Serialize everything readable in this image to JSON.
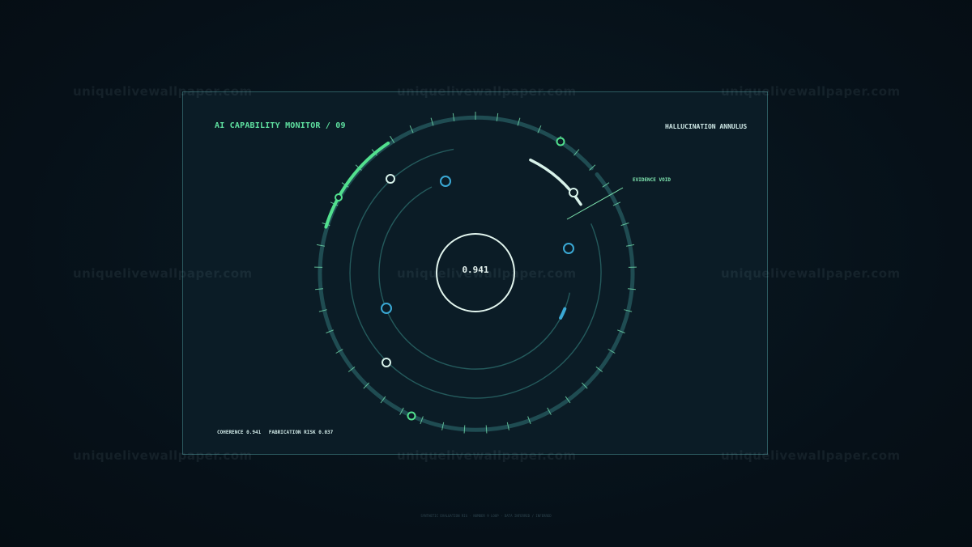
{
  "header": {
    "title": "AI CAPABILITY MONITOR / 09",
    "subtitle": "HALLUCINATION ANNULUS"
  },
  "callout": {
    "label": "EVIDENCE VOID"
  },
  "gauge": {
    "center_value": "0.941"
  },
  "metrics": {
    "coherence": "COHERENCE 0.941",
    "fabrication_risk": "FABRICATION RISK 0.037"
  },
  "footer": {
    "text": "SYNTHETIC EVALUATION RIG · NUMBER 9 LOOP · DATA INFERRED / INFERRED"
  },
  "watermark": {
    "text": "uniquelivewallpaper.com"
  },
  "colors": {
    "background": "#071219",
    "panel": "#0b1c26",
    "panel_border": "#2c5a60",
    "accent_green": "#5fe0a0",
    "accent_cyan": "#3aa8d4",
    "ring_teal": "#245a5c",
    "node_white": "#cfe8e6"
  }
}
